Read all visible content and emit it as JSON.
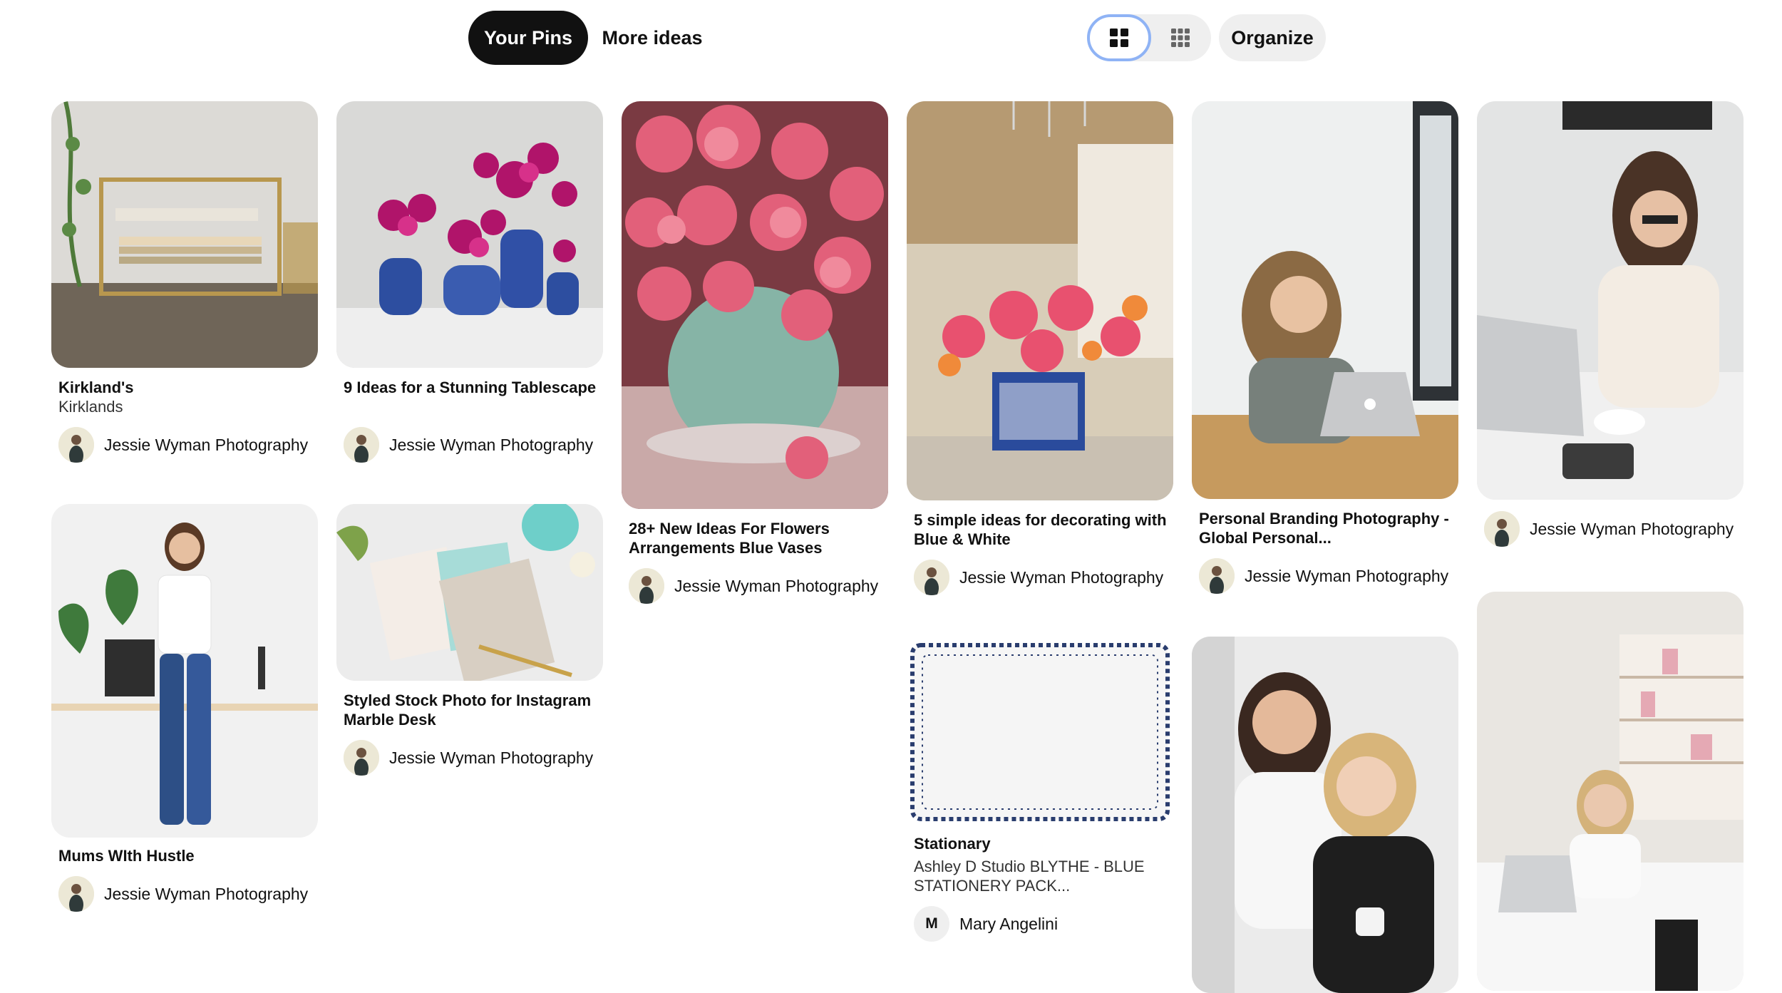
{
  "tabs": {
    "your_pins": "Your Pins",
    "more_ideas": "More ideas"
  },
  "toolbar": {
    "organize": "Organize"
  },
  "pins": [
    {
      "title": "Kirkland's",
      "subtitle": "Kirklands",
      "author": "Jessie Wyman Photography"
    },
    {
      "title": "9 Ideas for a Stunning Tablescape",
      "author": "Jessie Wyman Photography"
    },
    {
      "title": "28+ New Ideas For Flowers Arrangements Blue Vases",
      "author": "Jessie Wyman Photography"
    },
    {
      "title": "5 simple ideas for decorating with Blue & White",
      "author": "Jessie Wyman Photography"
    },
    {
      "title": "Personal Branding Photography - Global Personal...",
      "author": "Jessie Wyman Photography"
    },
    {
      "author": "Jessie Wyman Photography"
    },
    {
      "title": "Mums WIth Hustle",
      "author": "Jessie Wyman Photography"
    },
    {
      "title": "Styled Stock Photo for Instagram Marble Desk",
      "author": "Jessie Wyman Photography"
    },
    {
      "title": "Stationary",
      "subtitle": "Ashley D Studio BLYTHE - BLUE STATIONERY PACK...",
      "author": "Mary Angelini",
      "avatar_letter": "M"
    },
    {},
    {}
  ],
  "colors": {
    "active_tab_bg": "#111111",
    "toggle_focus": "#8fb3f5",
    "pill_grey": "#efefef"
  }
}
